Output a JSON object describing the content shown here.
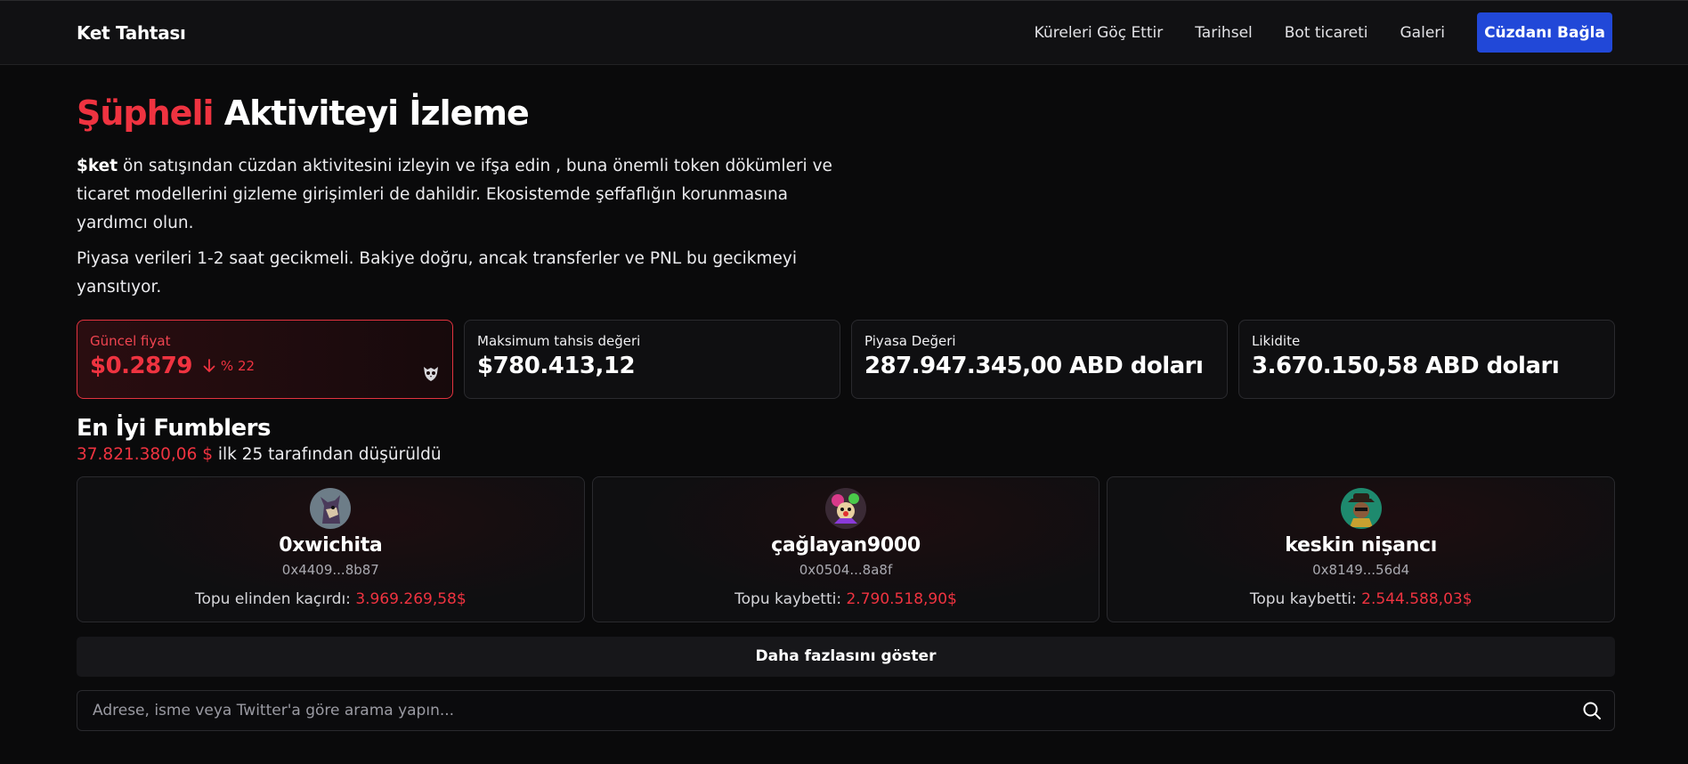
{
  "nav": {
    "brand": "Ket Tahtası",
    "links": [
      "Küreleri Göç Ettir",
      "Tarihsel",
      "Bot ticareti",
      "Galeri"
    ],
    "connect_label": "Cüzdanı Bağla",
    "connect_color": "#2148d8"
  },
  "hero": {
    "title_accent": "Şüpheli",
    "title_rest": " Aktiviteyi İzleme",
    "desc_bold": "$ket",
    "desc_rest": " ön satışından cüzdan aktivitesini izleyin ve ifşa edin , buna önemli token dökümleri ve ticaret modellerini gizleme girişimleri de dahildir. Ekosistemde şeffaflığın korunmasına yardımcı olun.",
    "desc2": "Piyasa verileri 1-2 saat gecikmeli. Bakiye doğru, ancak transferler ve PNL bu gecikmeyi yansıtıyor."
  },
  "stats": [
    {
      "label": "Güncel fiyat",
      "value": "$0.2879",
      "change": "% 22",
      "change_direction": "down",
      "icon": "owl-icon"
    },
    {
      "label": "Maksimum tahsis değeri",
      "value": "$780.413,12"
    },
    {
      "label": "Piyasa Değeri",
      "value": "287.947.345,00 ABD doları"
    },
    {
      "label": "Likidite",
      "value": "3.670.150,58 ABD doları"
    }
  ],
  "fumblers": {
    "title": "En İyi Fumblers",
    "sub_amount": "37.821.380,06 $",
    "sub_rest": " ilk 25 tarafından düşürüldü",
    "cards": [
      {
        "name": "0xwichita",
        "address": "0x4409...8b87",
        "label": "Topu elinden kaçırdı: ",
        "amount": "3.969.269,58$",
        "avatar": "avatar-wolf"
      },
      {
        "name": "çağlayan9000",
        "address": "0x0504...8a8f",
        "label": "Topu kaybetti: ",
        "amount": "2.790.518,90$",
        "avatar": "avatar-clown"
      },
      {
        "name": "keskin nişancı",
        "address": "0x8149...56d4",
        "label": "Topu kaybetti: ",
        "amount": "2.544.588,03$",
        "avatar": "avatar-cowboy"
      }
    ],
    "more_label": "Daha fazlasını göster"
  },
  "search": {
    "placeholder": "Adrese, isme veya Twitter'a göre arama yapın...",
    "value": ""
  },
  "colors": {
    "accent_red": "#ef3340",
    "background": "#0a0a0b"
  }
}
